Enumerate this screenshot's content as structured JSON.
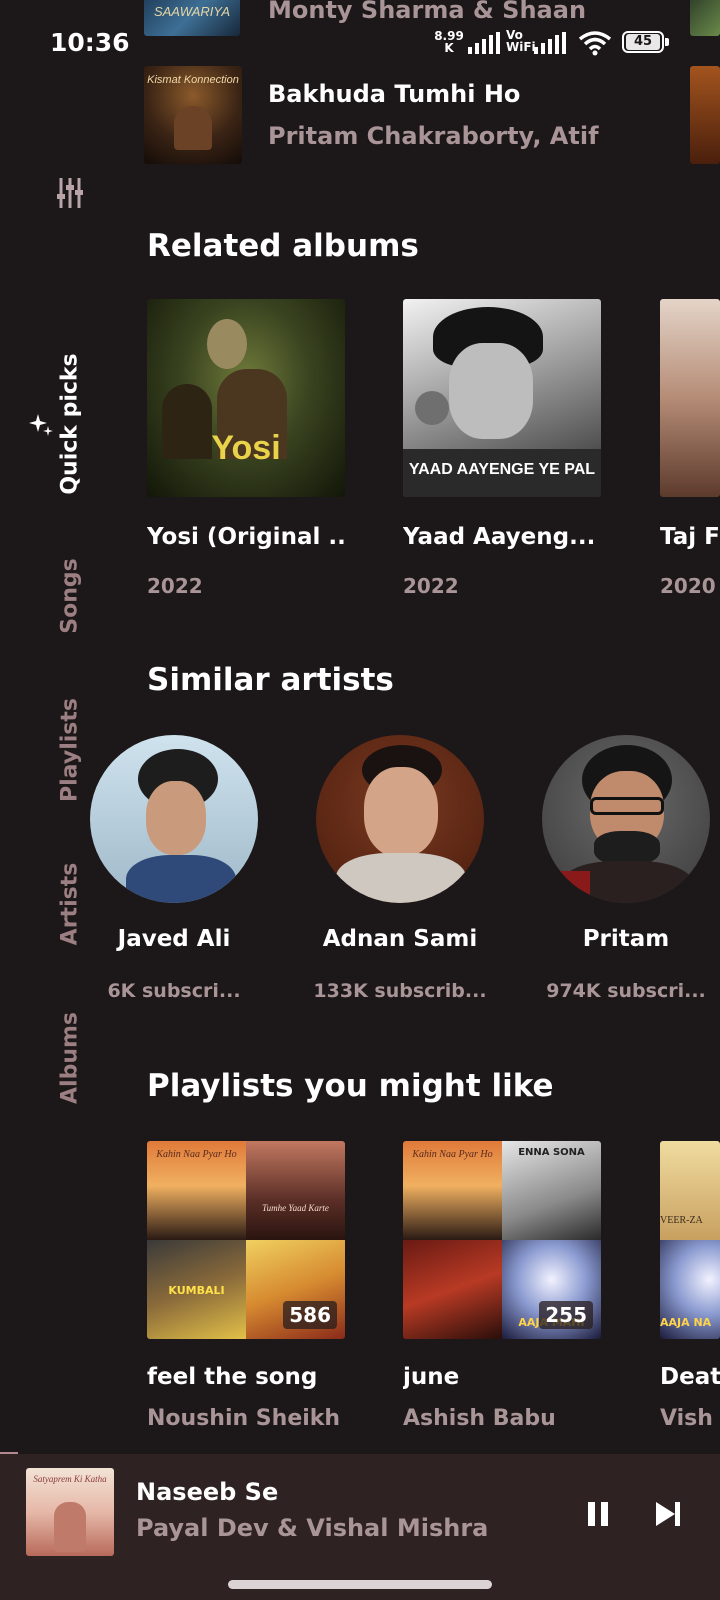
{
  "status_bar": {
    "time": "10:36",
    "net_speed_value": "8.99",
    "net_speed_unit": "K",
    "volte_top": "Vo",
    "volte_bottom": "WiFi",
    "battery": "45"
  },
  "top_songs": [
    {
      "title": "Monty Sharma & Shaan",
      "art_text": "SAAWARIYA"
    },
    {
      "title": "Bakhuda Tumhi Ho",
      "artist": "Pritam Chakraborty, Atif",
      "art_text": "Kismat Konnection"
    }
  ],
  "rail": {
    "tabs": [
      {
        "label": "Quick picks",
        "active": true
      },
      {
        "label": "Songs",
        "active": false
      },
      {
        "label": "Playlists",
        "active": false
      },
      {
        "label": "Artists",
        "active": false
      },
      {
        "label": "Albums",
        "active": false
      }
    ]
  },
  "related_albums": {
    "title": "Related albums",
    "items": [
      {
        "title": "Yosi (Original ...",
        "year": "2022",
        "art_text": "Yosi"
      },
      {
        "title": "Yaad Aayeng...",
        "year": "2022",
        "art_text": "YAAD AAYENGE YE PAL"
      },
      {
        "title": "Taj F",
        "year": "2020"
      }
    ]
  },
  "similar_artists": {
    "title": "Similar artists",
    "items": [
      {
        "name": "Javed Ali",
        "subscribers": "6K subscri..."
      },
      {
        "name": "Adnan Sami",
        "subscribers": "133K subscrib..."
      },
      {
        "name": "Pritam",
        "subscribers": "974K subscri..."
      }
    ]
  },
  "playlists": {
    "title": "Playlists you might like",
    "items": [
      {
        "title": "feel the song",
        "owner": "Noushin Sheikh",
        "count": "586",
        "tile_texts": [
          "Kahin Naa Pyar Ho",
          "Tumhe Yaad Karte",
          "KUMBALI",
          ""
        ]
      },
      {
        "title": "june",
        "owner": "Ashish Babu",
        "count": "255",
        "tile_texts": [
          "Kahin Naa Pyar Ho",
          "ENNA SONA",
          "",
          "AAJA MAHI"
        ]
      },
      {
        "title": "Deat",
        "owner": "Vish",
        "tile_texts": [
          "VEER-ZA",
          "AAJA NA"
        ]
      }
    ]
  },
  "now_playing": {
    "title": "Naseeb Se",
    "artist": "Payal Dev & Vishal Mishra",
    "art_text": "Satyaprem Ki Katha"
  },
  "colors": {
    "background": "#1c1718",
    "player_background": "#2e2223",
    "secondary_text": "#a99597",
    "rail_inactive": "#9c7f83"
  }
}
